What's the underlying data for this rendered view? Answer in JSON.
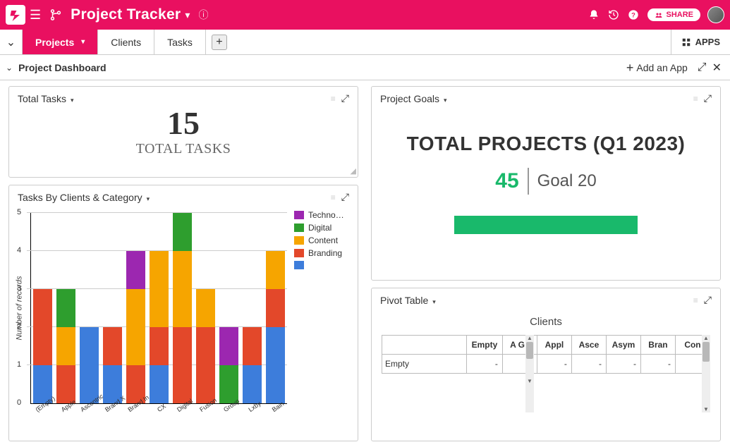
{
  "topbar": {
    "title": "Project Tracker",
    "share_label": "SHARE"
  },
  "tabs": {
    "items": [
      "Projects",
      "Clients",
      "Tasks"
    ],
    "apps_label": "APPS"
  },
  "subbar": {
    "title": "Project Dashboard",
    "add_app": "Add an App"
  },
  "panels": {
    "total_tasks": {
      "title": "Total Tasks",
      "value": "15",
      "label": "TOTAL TASKS"
    },
    "tasks_by_clients": {
      "title": "Tasks By Clients & Category",
      "ylabel": "Number of records"
    },
    "project_goals": {
      "title": "Project Goals",
      "headline": "TOTAL PROJECTS (Q1 2023)",
      "value": "45",
      "goal_label": "Goal 20"
    },
    "pivot": {
      "title": "Pivot Table",
      "group_title": "Clients",
      "columns": [
        "Empty",
        "A G I",
        "Appl",
        "Asce",
        "Asym",
        "Bran",
        "Con"
      ],
      "rows": [
        {
          "label": "Empty",
          "values": [
            "-",
            "-",
            "-",
            "-",
            "-",
            "-",
            "-"
          ]
        }
      ]
    }
  },
  "chart_data": {
    "type": "bar",
    "stacked": true,
    "ylabel": "Number of records",
    "ylim": [
      0,
      5
    ],
    "categories": [
      "(Empty)",
      "Apple",
      "Ascentric",
      "Brand X",
      "Brand In",
      "CX",
      "Digital",
      "Fusion",
      "Group",
      "Lxby",
      "Bain"
    ],
    "series": [
      {
        "name": "Techno…",
        "color": "#9c27b0"
      },
      {
        "name": "Digital",
        "color": "#2e9e2e"
      },
      {
        "name": "Content",
        "color": "#f6a500"
      },
      {
        "name": "Branding",
        "color": "#e3482a"
      },
      {
        "name": "",
        "color": "#3d7ddb"
      }
    ],
    "stacks": [
      {
        "Branding": 2,
        "": 1
      },
      {
        "Digital": 1,
        "Branding": 1,
        "Content": 1
      },
      {
        "": 2
      },
      {
        "Branding": 1,
        "": 1
      },
      {
        "Techno…": 1,
        "Content": 2,
        "Branding": 1
      },
      {
        "Content": 2,
        "Branding": 1,
        "": 1
      },
      {
        "Digital": 1,
        "Content": 2,
        "Branding": 2
      },
      {
        "Content": 1,
        "Branding": 2
      },
      {
        "Techno…": 1,
        "Digital": 1
      },
      {
        "Branding": 1,
        "": 1
      },
      {
        "Content": 1,
        "Branding": 1,
        "": 2
      }
    ]
  },
  "colors": {
    "brand": "#e91060",
    "green": "#19b96b"
  }
}
